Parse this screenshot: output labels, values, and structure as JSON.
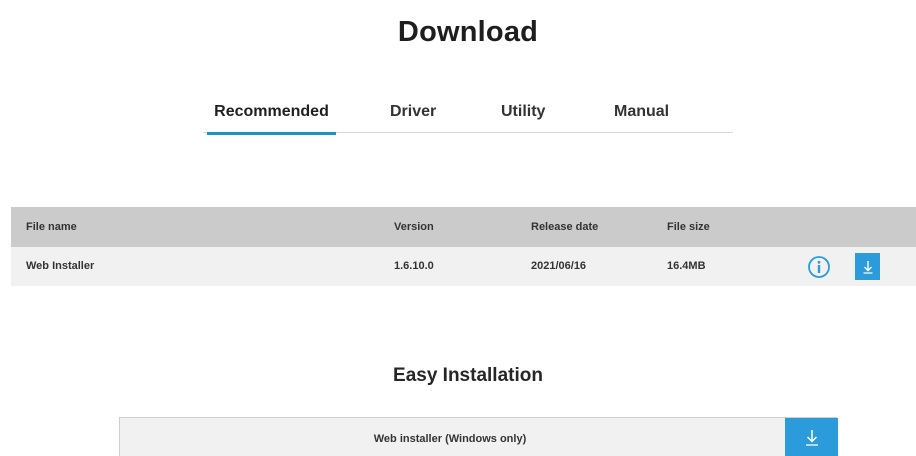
{
  "page": {
    "title": "Download"
  },
  "tabs": [
    {
      "label": "Recommended",
      "active": true
    },
    {
      "label": "Driver",
      "active": false
    },
    {
      "label": "Utility",
      "active": false
    },
    {
      "label": "Manual",
      "active": false
    }
  ],
  "file_table": {
    "columns": [
      "File name",
      "Version",
      "Release date",
      "File size"
    ],
    "rows": [
      {
        "name": "Web Installer",
        "version": "1.6.10.0",
        "release_date": "2021/06/16",
        "size": "16.4MB",
        "actions": [
          "info-icon",
          "download-icon"
        ]
      }
    ]
  },
  "easy_installation": {
    "title": "Easy Installation",
    "label": "Web installer (Windows only)",
    "action_icon": "download-icon"
  },
  "colors": {
    "accent": "#2b9bdc",
    "header_bg": "#cbcbcb",
    "row_bg": "#f1f1f1"
  }
}
